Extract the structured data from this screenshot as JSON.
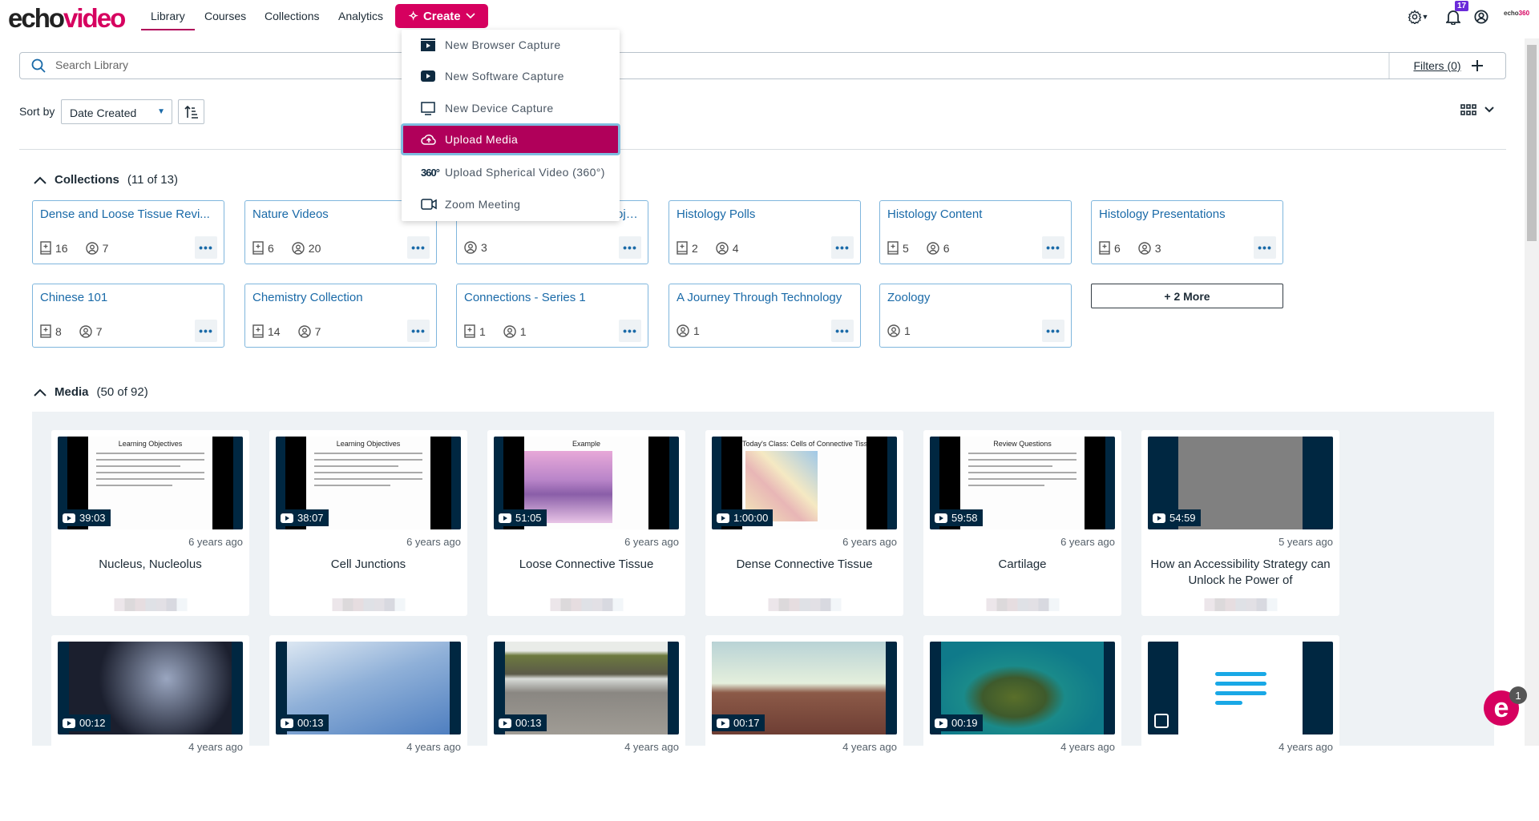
{
  "header": {
    "logo_a": "echo",
    "logo_b": "video",
    "nav": [
      "Library",
      "Courses",
      "Collections",
      "Analytics"
    ],
    "create_label": "Create",
    "notifications_count": "17",
    "brand_small_a": "echo",
    "brand_small_b": "360"
  },
  "create_menu": [
    {
      "label": "New Browser Capture",
      "icon": "browser-capture-icon"
    },
    {
      "label": "New Software Capture",
      "icon": "software-capture-icon"
    },
    {
      "label": "New Device Capture",
      "icon": "monitor-icon"
    },
    {
      "label": "Upload Media",
      "icon": "cloud-upload-icon",
      "selected": true
    },
    {
      "label": "Upload Spherical Video (360°)",
      "icon": "360-icon",
      "icon_text": "360°"
    },
    {
      "label": "Zoom Meeting",
      "icon": "video-camera-icon"
    }
  ],
  "search": {
    "placeholder": "Search Library",
    "filters_label": "Filters (0)"
  },
  "sort": {
    "label": "Sort by",
    "value": "Date Created"
  },
  "collections": {
    "title": "Collections",
    "count": "(11 of 13)",
    "more_label": "+ 2 More",
    "items": [
      {
        "title": "Dense and Loose Tissue Revi...",
        "media": "16",
        "users": "7"
      },
      {
        "title": "Nature Videos",
        "media": "6",
        "users": "20"
      },
      {
        "title": "oje...",
        "media": null,
        "users": "3"
      },
      {
        "title": "Histology Polls",
        "media": "2",
        "users": "4"
      },
      {
        "title": "Histology Content",
        "media": "5",
        "users": "6"
      },
      {
        "title": "Histology Presentations",
        "media": "6",
        "users": "3"
      },
      {
        "title": "Chinese 101",
        "media": "8",
        "users": "7"
      },
      {
        "title": "Chemistry Collection",
        "media": "14",
        "users": "7"
      },
      {
        "title": "Connections - Series 1",
        "media": "1",
        "users": "1"
      },
      {
        "title": "A Journey Through Technology",
        "media": null,
        "users": "1"
      },
      {
        "title": "Zoology",
        "media": null,
        "users": "1"
      }
    ]
  },
  "media": {
    "title": "Media",
    "count": "(50 of 92)",
    "items": [
      {
        "duration": "39:03",
        "age": "6 years ago",
        "title": "Nucleus, Nucleolus",
        "thumb": "slide",
        "slide_title": "Learning Objectives"
      },
      {
        "duration": "38:07",
        "age": "6 years ago",
        "title": "Cell Junctions",
        "thumb": "slide",
        "slide_title": "Learning Objectives"
      },
      {
        "duration": "51:05",
        "age": "6 years ago",
        "title": "Loose Connective Tissue",
        "thumb": "histology",
        "slide_title": "Example"
      },
      {
        "duration": "1:00:00",
        "age": "6 years ago",
        "title": "Dense Connective Tissue",
        "thumb": "diagram",
        "slide_title": "Today's Class: Cells of Connective Tissue"
      },
      {
        "duration": "59:58",
        "age": "6 years ago",
        "title": "Cartilage",
        "thumb": "slide",
        "slide_title": "Review Questions"
      },
      {
        "duration": "54:59",
        "age": "5 years ago",
        "title": "How an Accessibility Strategy can Unlock he Power of",
        "thumb": "gray"
      },
      {
        "duration": "00:12",
        "age": "4 years ago",
        "thumb": "trees"
      },
      {
        "duration": "00:13",
        "age": "4 years ago",
        "thumb": "clouds"
      },
      {
        "duration": "00:13",
        "age": "4 years ago",
        "thumb": "waterfall"
      },
      {
        "duration": "00:17",
        "age": "4 years ago",
        "thumb": "desert"
      },
      {
        "duration": "00:19",
        "age": "4 years ago",
        "thumb": "island"
      },
      {
        "duration": null,
        "age": "4 years ago",
        "thumb": "document"
      }
    ]
  },
  "chat_badge": "1",
  "colors": {
    "brand": "#d6005f",
    "selected": "#b0005a",
    "link": "#1a6aa8",
    "navy": "#002741",
    "panel": "#eef2f5"
  }
}
